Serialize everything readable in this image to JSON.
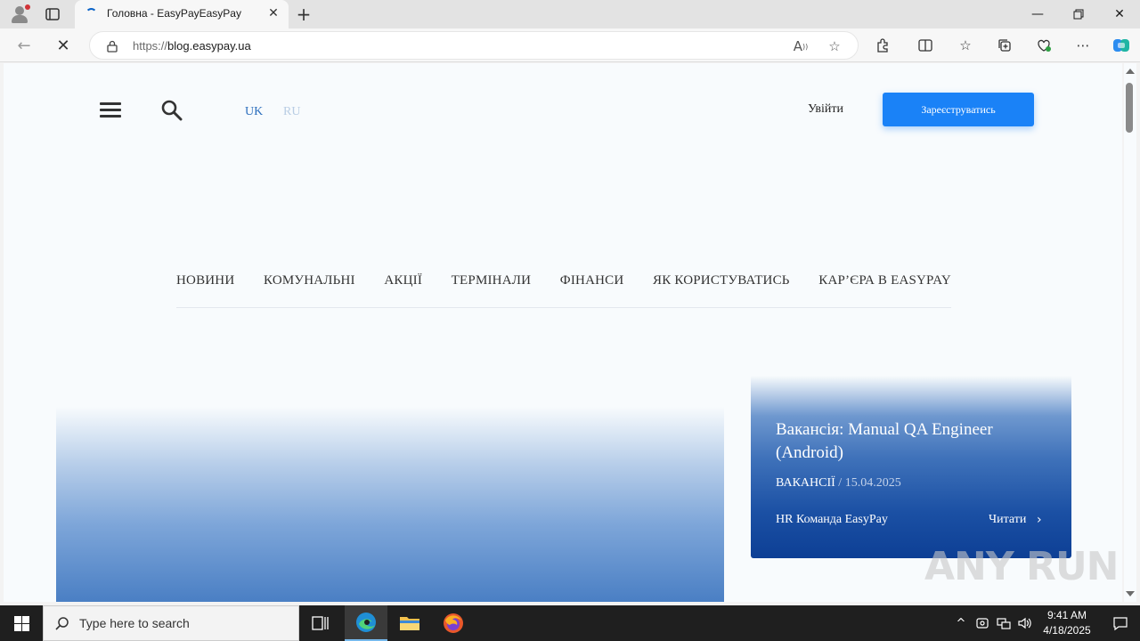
{
  "browser": {
    "tab_title": "Головна - EasyPayEasyPay",
    "url_protocol": "https://",
    "url_host": "blog.easypay.ua"
  },
  "header": {
    "lang_uk": "UK",
    "lang_ru": "RU",
    "login": "Увійти",
    "register": "Зареєструватись"
  },
  "nav": {
    "items": [
      "НОВИНИ",
      "КОМУНАЛЬНІ",
      "АКЦІЇ",
      "ТЕРМІНАЛИ",
      "ФІНАНСИ",
      "ЯК КОРИСТУВАТИСЬ",
      "КАР’ЄРА В EASYPAY"
    ]
  },
  "featured": {
    "title": "Вакансія: Manual QA Engineer (Android)",
    "category": "ВАКАНСІЇ",
    "separator": " / ",
    "date": "15.04.2025",
    "author": "HR Команда EasyPay",
    "read": "Читати"
  },
  "watermark": "ANY RUN",
  "taskbar": {
    "search_placeholder": "Type here to search",
    "time": "9:41 AM",
    "date": "4/18/2025"
  },
  "colors": {
    "accent": "#1a82f7",
    "lang_active": "#2d6fbd",
    "card_dark": "#0d3f95"
  }
}
